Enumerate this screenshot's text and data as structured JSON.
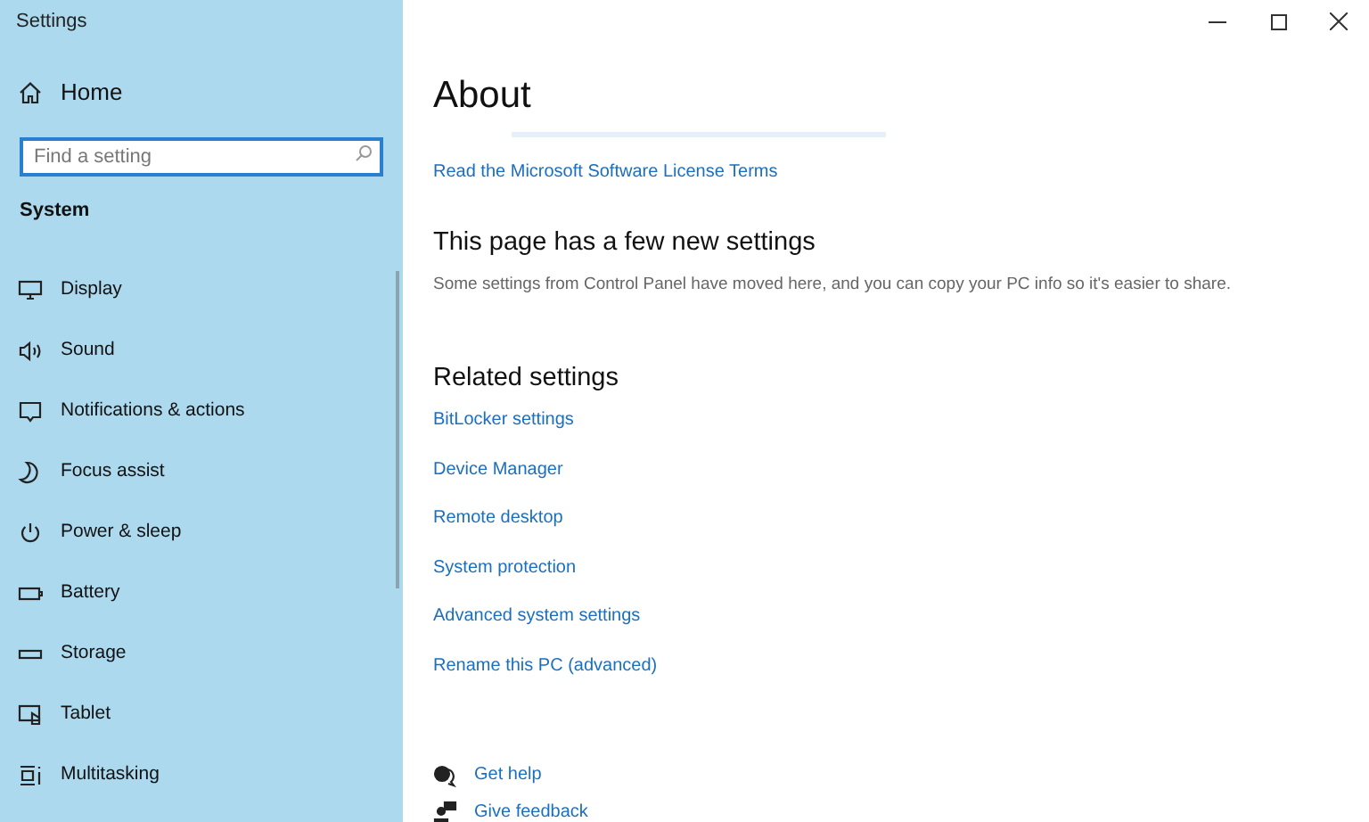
{
  "window": {
    "title": "Settings"
  },
  "sidebar": {
    "home": "Home",
    "search": {
      "placeholder": "Find a setting"
    },
    "section": "System",
    "items": [
      {
        "label": "Display"
      },
      {
        "label": "Sound"
      },
      {
        "label": "Notifications & actions"
      },
      {
        "label": "Focus assist"
      },
      {
        "label": "Power & sleep"
      },
      {
        "label": "Battery"
      },
      {
        "label": "Storage"
      },
      {
        "label": "Tablet"
      },
      {
        "label": "Multitasking"
      }
    ]
  },
  "content": {
    "title": "About",
    "license_link": "Read the Microsoft Software License Terms",
    "new_settings": {
      "heading": "This page has a few new settings",
      "text": "Some settings from Control Panel have moved here, and you can copy your PC info so it's easier to share."
    },
    "related": {
      "heading": "Related settings",
      "links": [
        "BitLocker settings",
        "Device Manager",
        "Remote desktop",
        "System protection",
        "Advanced system settings",
        "Rename this PC (advanced)"
      ]
    },
    "help": [
      {
        "label": "Get help"
      },
      {
        "label": "Give feedback"
      }
    ]
  }
}
